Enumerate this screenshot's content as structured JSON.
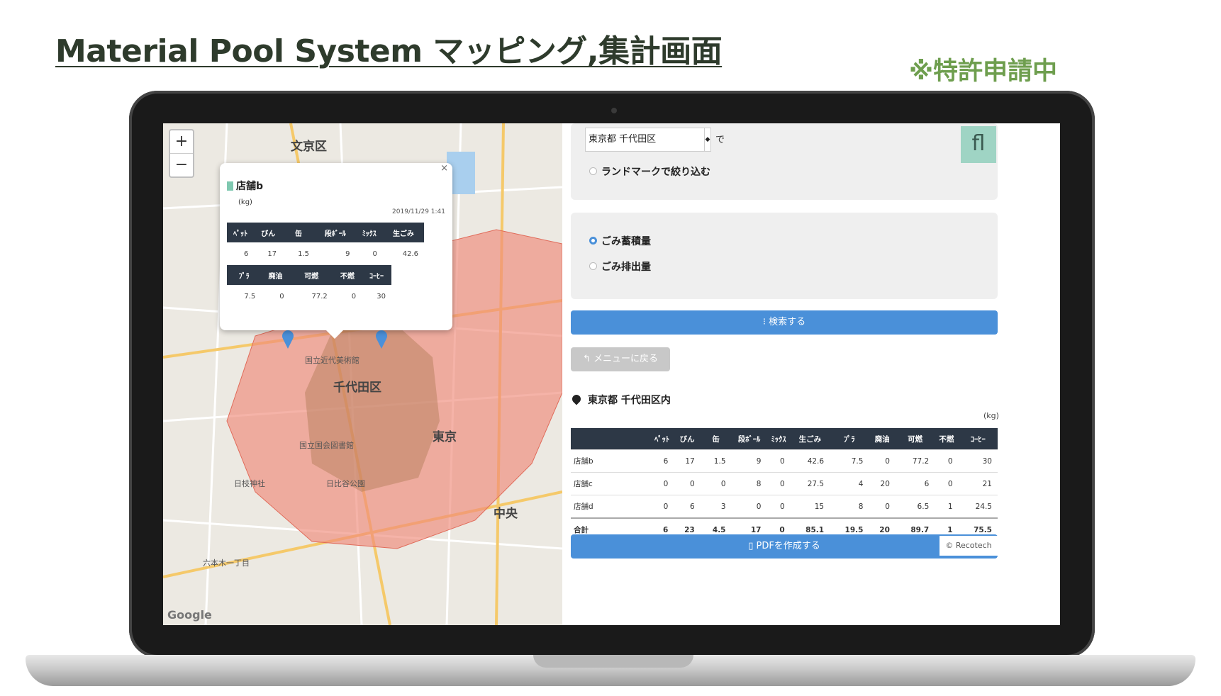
{
  "slide": {
    "title": "Material Pool System マッピング,集計画面",
    "patent_note": "※特許申請中"
  },
  "map": {
    "zoom_in": "+",
    "zoom_out": "−",
    "labels": {
      "bunkyo": "文京区",
      "chiyoda": "千代田区",
      "tokyo": "東京",
      "chuo": "中央",
      "imperial_museum": "国立近代美術館",
      "national_diet": "国立国会図書館",
      "hie_shrine": "日枝神社",
      "hibiya": "日比谷公園",
      "roppongi": "六本木一丁目"
    },
    "google": "Google",
    "popup": {
      "close": "×",
      "store": "店舗b",
      "unit": "(kg)",
      "date": "2019/11/29 1:41",
      "headers1": [
        "ﾍﾟｯﾄ",
        "びん",
        "缶",
        "段ﾎﾞｰﾙ",
        "ﾐｯｸｽ",
        "生ごみ"
      ],
      "values1": [
        "6",
        "17",
        "1.5",
        "9",
        "0",
        "42.6"
      ],
      "headers2": [
        "ﾌﾟﾗ",
        "廃油",
        "可燃",
        "不燃",
        "ｺｰﾋｰ"
      ],
      "values2": [
        "7.5",
        "0",
        "77.2",
        "0",
        "30"
      ]
    }
  },
  "panel": {
    "area_select": "東京都 千代田区",
    "area_suffix": "で",
    "landmark_label": "ランドマークで絞り込む",
    "fl_button": "fl",
    "radio_stock": "ごみ蓄積量",
    "radio_emission": "ごみ排出量",
    "search_button": "検索する",
    "back_button": "メニューに戻る",
    "location": "東京都 千代田区内",
    "unit": "(kg)",
    "table_headers": [
      "",
      "ﾍﾟｯﾄ",
      "びん",
      "缶",
      "段ﾎﾞｰﾙ",
      "ﾐｯｸｽ",
      "生ごみ",
      "ﾌﾟﾗ",
      "廃油",
      "可燃",
      "不燃",
      "ｺｰﾋｰ"
    ],
    "rows": [
      [
        "店舗b",
        "6",
        "17",
        "1.5",
        "9",
        "0",
        "42.6",
        "7.5",
        "0",
        "77.2",
        "0",
        "30"
      ],
      [
        "店舗c",
        "0",
        "0",
        "0",
        "8",
        "0",
        "27.5",
        "4",
        "20",
        "6",
        "0",
        "21"
      ],
      [
        "店舗d",
        "0",
        "6",
        "3",
        "0",
        "0",
        "15",
        "8",
        "0",
        "6.5",
        "1",
        "24.5"
      ],
      [
        "合計",
        "6",
        "23",
        "4.5",
        "17",
        "0",
        "85.1",
        "19.5",
        "20",
        "89.7",
        "1",
        "75.5"
      ]
    ],
    "pdf_button": "PDFを作成する",
    "copyright": "© Recotech"
  },
  "colors": {
    "accent": "#4a90d9",
    "table_header": "#2d3846",
    "area_fill": "#f08a7a",
    "title": "#2e3b2c",
    "patent": "#6e9e4e"
  }
}
